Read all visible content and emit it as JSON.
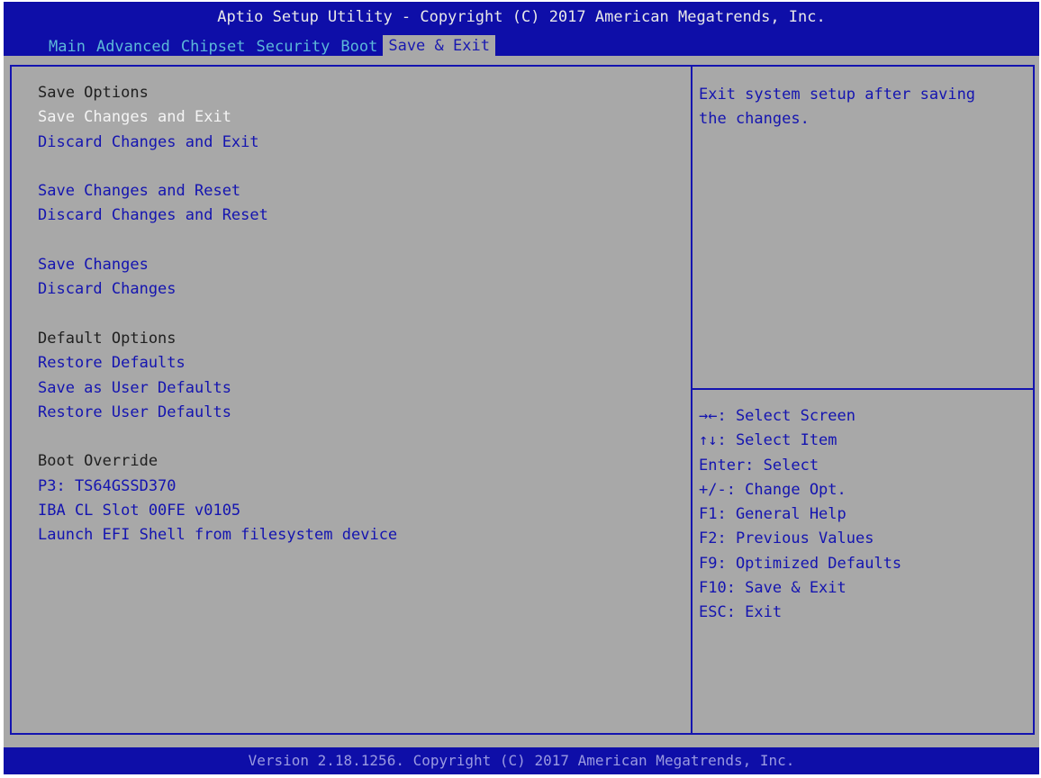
{
  "header": {
    "title": "Aptio Setup Utility - Copyright (C) 2017 American Megatrends, Inc.",
    "tabs": [
      "Main",
      "Advanced",
      "Chipset",
      "Security",
      "Boot",
      "Save & Exit"
    ],
    "active_tab": "Save & Exit"
  },
  "main": {
    "save_options_header": "Save Options",
    "save_changes_and_exit": "Save Changes and Exit",
    "discard_changes_and_exit": "Discard Changes and Exit",
    "save_changes_and_reset": "Save Changes and Reset",
    "discard_changes_and_reset": "Discard Changes and Reset",
    "save_changes": "Save Changes",
    "discard_changes": "Discard Changes",
    "default_options_header": "Default Options",
    "restore_defaults": "Restore Defaults",
    "save_as_user_defaults": "Save as User Defaults",
    "restore_user_defaults": "Restore User Defaults",
    "boot_override_header": "Boot Override",
    "boot_devices": [
      "P3: TS64GSSD370",
      "IBA CL Slot 00FE v0105",
      "Launch EFI Shell from filesystem device"
    ],
    "selected_item": "Save Changes and Exit"
  },
  "help": {
    "text": "Exit system setup after saving\nthe changes."
  },
  "keys": [
    "→←: Select Screen",
    "↑↓: Select Item",
    "Enter: Select",
    "+/-: Change Opt.",
    "F1: General Help",
    "F2: Previous Values",
    "F9: Optimized Defaults",
    "F10: Save & Exit",
    "ESC: Exit"
  ],
  "footer": {
    "version": "Version 2.18.1256. Copyright (C) 2017 American Megatrends, Inc."
  },
  "colors": {
    "header_bg": "#0e0ea8",
    "body_bg": "#a8a8a8",
    "option_text": "#1414b0",
    "selected_text": "#f4f4f4",
    "inactive_tab": "#5cb8d8"
  }
}
